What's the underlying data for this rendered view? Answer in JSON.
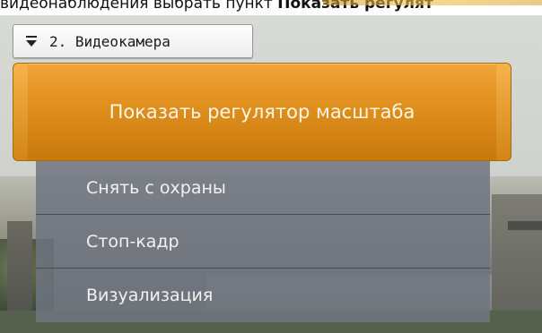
{
  "doc": {
    "text_prefix": "видеонаблюдения выбрать пункт ",
    "text_bold": "Показать регулят"
  },
  "camera": {
    "title": "2. Видеокамера",
    "dropdown_icon": "dropdown-arrow-icon"
  },
  "action_button": {
    "label": "Показать регулятор масштаба"
  },
  "menu": {
    "items": [
      {
        "label": "Снять с охраны"
      },
      {
        "label": "Стоп-кадр"
      },
      {
        "label": "Визуализация"
      }
    ]
  },
  "colors": {
    "action_orange": "#e1911f",
    "menu_gray": "#70747f"
  }
}
